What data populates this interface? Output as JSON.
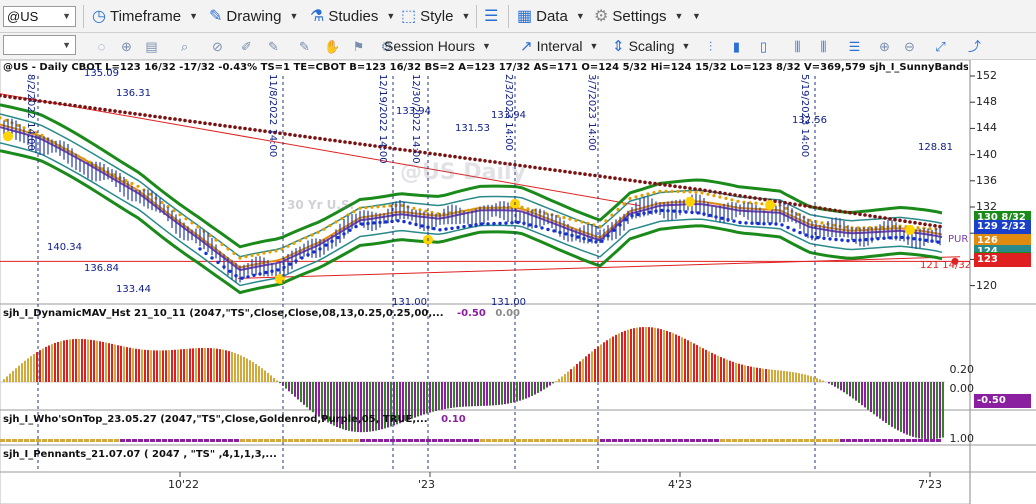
{
  "toolbar": {
    "symbol": "@US",
    "timeframe": "Timeframe",
    "drawing": "Drawing",
    "studies": "Studies",
    "style": "Style",
    "data": "Data",
    "settings": "Settings",
    "session_hours": "Session Hours",
    "interval": "Interval",
    "scaling": "Scaling"
  },
  "chart": {
    "header": "@US - Daily  CBOT  L=123 16/32  -17/32  -0.43%  TS=1  TE=CBOT  B=123 16/32  BS=2  A=123 17/32  AS=171  O=124 5/32  Hi=124 15/32  Lo=123 8/32  V=369,579  sjh_I_SunnyBands$$_22.11.0...",
    "watermark": "@US Daily",
    "sub_watermark": "30 Yr U.S.",
    "colors": {
      "price_bars": "#1f3aa8",
      "band_outer": "#1a8a1a",
      "band_teal": "#2a8a8a",
      "ma_orange": "#e08a10",
      "ma_purple": "#7a3fa0",
      "dot_blue": "#1530d0",
      "dot_darkred": "#7a1010",
      "dot_orange": "#e0a000",
      "hist_red": "#e02020",
      "hist_gold": "#d4a93c",
      "hist_green": "#2a8a1a",
      "hist_purple": "#8a1fa0",
      "trend_red": "#e02020"
    },
    "price_axis": {
      "ticks": [
        "152",
        "148",
        "144",
        "140",
        "136",
        "132",
        "128",
        "124",
        "120"
      ],
      "boxes": [
        {
          "text": "130 8/32",
          "color": "#1a8a1a"
        },
        {
          "text": "129 2/32",
          "color": "#1a3fc8"
        },
        {
          "text": "126 24/32",
          "color": "#e08a10"
        },
        {
          "text": "124 27/32",
          "color": "#2a8a8a"
        },
        {
          "text": "124 3/32",
          "color": "#1a8a1a"
        },
        {
          "text": "123 24/32",
          "color": "#e02020"
        }
      ],
      "pur_label": "PUR",
      "last_label": "121 14/32"
    },
    "price_labels": [
      "135.09",
      "136.31",
      "140.34",
      "136.84",
      "133.44",
      "133.94",
      "131.53",
      "133.94",
      "132.56",
      "128.81",
      "131.00",
      "131.00"
    ],
    "vertical_labels": [
      "8/2/2022 14:00",
      "11/8/2022 14:00",
      "12/19/2022 14:00",
      "12/30/2022 14:00",
      "2/3/2023 14:00",
      "3/7/2023 14:00",
      "5/19/2023 14:00"
    ],
    "x_axis": [
      "10'22",
      "'23",
      "4'23",
      "7'23"
    ],
    "dynamic_pane": {
      "label": "sjh_I_DynamicMAV_Hst 21_10_11 (2047,\"TS\",Close,Close,08,13,0.25,0.25,00,...",
      "v1": "-0.50",
      "v2": "0.00",
      "ticks": [
        "0.20",
        "0.00"
      ],
      "last_box": "-0.50"
    },
    "whos_pane": {
      "label": "sjh_I_Who'sOnTop_23.05.27 (2047,\"TS\",Close,Goldenrod,Purple,05,  TRUE,...",
      "v1": "0.10",
      "ticks": [
        "1.00"
      ]
    },
    "pennants_pane": {
      "label": "sjh_I_Pennants_21.07.07 ( 2047 , \"TS\" ,4,1,1,3,..."
    }
  }
}
